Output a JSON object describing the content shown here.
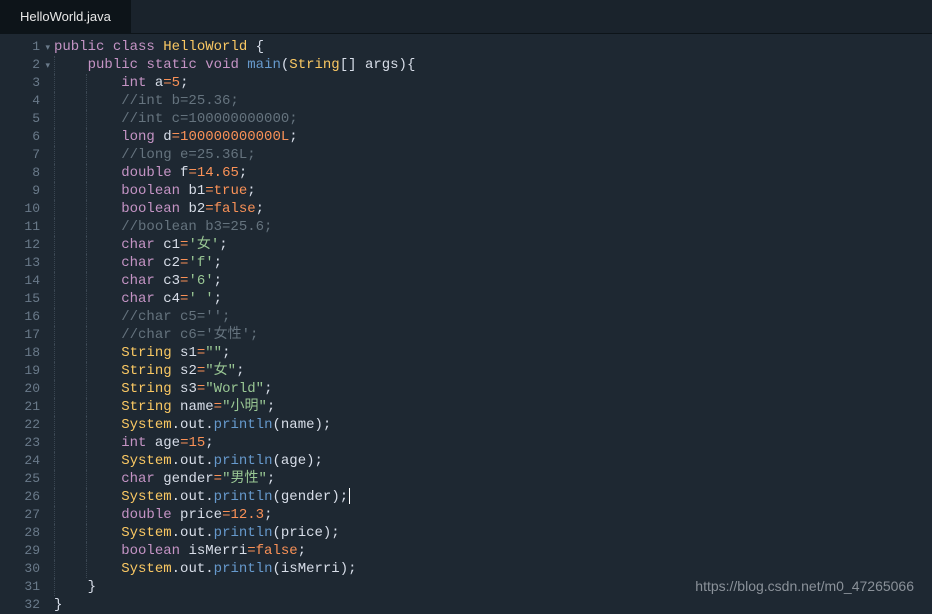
{
  "tab": {
    "filename": "HelloWorld.java"
  },
  "watermark": "https://blog.csdn.net/m0_47265066",
  "lines": [
    {
      "n": 1,
      "fold": true,
      "indent": 0,
      "tokens": [
        [
          "kw",
          "public"
        ],
        [
          "",
          ""
        ],
        [
          "kw",
          "class"
        ],
        [
          "",
          ""
        ],
        [
          "cls",
          "HelloWorld"
        ],
        [
          "",
          ""
        ],
        [
          "punct",
          "{"
        ]
      ]
    },
    {
      "n": 2,
      "fold": true,
      "indent": 1,
      "tokens": [
        [
          "kw",
          "public"
        ],
        [
          "",
          ""
        ],
        [
          "kw",
          "static"
        ],
        [
          "",
          ""
        ],
        [
          "type",
          "void"
        ],
        [
          "",
          ""
        ],
        [
          "fn",
          "main"
        ],
        [
          "punct",
          "("
        ],
        [
          "cls",
          "String"
        ],
        [
          "punct",
          "[]"
        ],
        [
          "",
          ""
        ],
        [
          "id",
          "args"
        ],
        [
          "punct",
          "){"
        ]
      ]
    },
    {
      "n": 3,
      "fold": false,
      "indent": 2,
      "tokens": [
        [
          "type",
          "int"
        ],
        [
          "",
          ""
        ],
        [
          "id",
          "a"
        ],
        [
          "op",
          "="
        ],
        [
          "num",
          "5"
        ],
        [
          "punct",
          ";"
        ]
      ]
    },
    {
      "n": 4,
      "fold": false,
      "indent": 2,
      "tokens": [
        [
          "comment",
          "//int b=25.36;"
        ]
      ]
    },
    {
      "n": 5,
      "fold": false,
      "indent": 2,
      "tokens": [
        [
          "comment",
          "//int c=100000000000;"
        ]
      ]
    },
    {
      "n": 6,
      "fold": false,
      "indent": 2,
      "tokens": [
        [
          "type",
          "long"
        ],
        [
          "",
          ""
        ],
        [
          "id",
          "d"
        ],
        [
          "op",
          "="
        ],
        [
          "num",
          "100000000000L"
        ],
        [
          "punct",
          ";"
        ]
      ]
    },
    {
      "n": 7,
      "fold": false,
      "indent": 2,
      "tokens": [
        [
          "comment",
          "//long e=25.36L;"
        ]
      ]
    },
    {
      "n": 8,
      "fold": false,
      "indent": 2,
      "tokens": [
        [
          "type",
          "double"
        ],
        [
          "",
          ""
        ],
        [
          "id",
          "f"
        ],
        [
          "op",
          "="
        ],
        [
          "num",
          "14.65"
        ],
        [
          "punct",
          ";"
        ]
      ]
    },
    {
      "n": 9,
      "fold": false,
      "indent": 2,
      "tokens": [
        [
          "type",
          "boolean"
        ],
        [
          "",
          ""
        ],
        [
          "id",
          "b1"
        ],
        [
          "op",
          "="
        ],
        [
          "bool",
          "true"
        ],
        [
          "punct",
          ";"
        ]
      ]
    },
    {
      "n": 10,
      "fold": false,
      "indent": 2,
      "tokens": [
        [
          "type",
          "boolean"
        ],
        [
          "",
          ""
        ],
        [
          "id",
          "b2"
        ],
        [
          "op",
          "="
        ],
        [
          "bool",
          "false"
        ],
        [
          "punct",
          ";"
        ]
      ]
    },
    {
      "n": 11,
      "fold": false,
      "indent": 2,
      "tokens": [
        [
          "comment",
          "//boolean b3=25.6;"
        ]
      ]
    },
    {
      "n": 12,
      "fold": false,
      "indent": 2,
      "tokens": [
        [
          "type",
          "char"
        ],
        [
          "",
          ""
        ],
        [
          "id",
          "c1"
        ],
        [
          "op",
          "="
        ],
        [
          "str",
          "'女'"
        ],
        [
          "punct",
          ";"
        ]
      ]
    },
    {
      "n": 13,
      "fold": false,
      "indent": 2,
      "tokens": [
        [
          "type",
          "char"
        ],
        [
          "",
          ""
        ],
        [
          "id",
          "c2"
        ],
        [
          "op",
          "="
        ],
        [
          "str",
          "'f'"
        ],
        [
          "punct",
          ";"
        ]
      ]
    },
    {
      "n": 14,
      "fold": false,
      "indent": 2,
      "tokens": [
        [
          "type",
          "char"
        ],
        [
          "",
          ""
        ],
        [
          "id",
          "c3"
        ],
        [
          "op",
          "="
        ],
        [
          "str",
          "'6'"
        ],
        [
          "punct",
          ";"
        ]
      ]
    },
    {
      "n": 15,
      "fold": false,
      "indent": 2,
      "tokens": [
        [
          "type",
          "char"
        ],
        [
          "",
          ""
        ],
        [
          "id",
          "c4"
        ],
        [
          "op",
          "="
        ],
        [
          "str",
          "' '"
        ],
        [
          "punct",
          ";"
        ]
      ]
    },
    {
      "n": 16,
      "fold": false,
      "indent": 2,
      "tokens": [
        [
          "comment",
          "//char c5='';"
        ]
      ]
    },
    {
      "n": 17,
      "fold": false,
      "indent": 2,
      "tokens": [
        [
          "comment",
          "//char c6='女性';"
        ]
      ]
    },
    {
      "n": 18,
      "fold": false,
      "indent": 2,
      "tokens": [
        [
          "cls",
          "String"
        ],
        [
          "",
          ""
        ],
        [
          "id",
          "s1"
        ],
        [
          "op",
          "="
        ],
        [
          "str",
          "\"\""
        ],
        [
          "punct",
          ";"
        ]
      ]
    },
    {
      "n": 19,
      "fold": false,
      "indent": 2,
      "tokens": [
        [
          "cls",
          "String"
        ],
        [
          "",
          ""
        ],
        [
          "id",
          "s2"
        ],
        [
          "op",
          "="
        ],
        [
          "str",
          "\"女\""
        ],
        [
          "punct",
          ";"
        ]
      ]
    },
    {
      "n": 20,
      "fold": false,
      "indent": 2,
      "tokens": [
        [
          "cls",
          "String"
        ],
        [
          "",
          ""
        ],
        [
          "id",
          "s3"
        ],
        [
          "op",
          "="
        ],
        [
          "str",
          "\"World\""
        ],
        [
          "punct",
          ";"
        ]
      ]
    },
    {
      "n": 21,
      "fold": false,
      "indent": 2,
      "tokens": [
        [
          "cls",
          "String"
        ],
        [
          "",
          ""
        ],
        [
          "id",
          "name"
        ],
        [
          "op",
          "="
        ],
        [
          "str",
          "\"小明\""
        ],
        [
          "punct",
          ";"
        ]
      ]
    },
    {
      "n": 22,
      "fold": false,
      "indent": 2,
      "tokens": [
        [
          "sys",
          "System"
        ],
        [
          "punct",
          "."
        ],
        [
          "id",
          "out"
        ],
        [
          "punct",
          "."
        ],
        [
          "fn",
          "println"
        ],
        [
          "punct",
          "("
        ],
        [
          "id",
          "name"
        ],
        [
          "punct",
          ");"
        ]
      ]
    },
    {
      "n": 23,
      "fold": false,
      "indent": 2,
      "tokens": [
        [
          "type",
          "int"
        ],
        [
          "",
          ""
        ],
        [
          "id",
          "age"
        ],
        [
          "op",
          "="
        ],
        [
          "num",
          "15"
        ],
        [
          "punct",
          ";"
        ]
      ]
    },
    {
      "n": 24,
      "fold": false,
      "indent": 2,
      "tokens": [
        [
          "sys",
          "System"
        ],
        [
          "punct",
          "."
        ],
        [
          "id",
          "out"
        ],
        [
          "punct",
          "."
        ],
        [
          "fn",
          "println"
        ],
        [
          "punct",
          "("
        ],
        [
          "id",
          "age"
        ],
        [
          "punct",
          ");"
        ]
      ]
    },
    {
      "n": 25,
      "fold": false,
      "indent": 2,
      "tokens": [
        [
          "type",
          "char"
        ],
        [
          "",
          ""
        ],
        [
          "id",
          "gender"
        ],
        [
          "op",
          "="
        ],
        [
          "str",
          "\"男性\""
        ],
        [
          "punct",
          ";"
        ]
      ]
    },
    {
      "n": 26,
      "fold": false,
      "indent": 2,
      "tokens": [
        [
          "sys",
          "System"
        ],
        [
          "punct",
          "."
        ],
        [
          "id",
          "out"
        ],
        [
          "punct",
          "."
        ],
        [
          "fn",
          "println"
        ],
        [
          "punct",
          "("
        ],
        [
          "id",
          "gender"
        ],
        [
          "punct",
          ");"
        ]
      ],
      "cursor": true
    },
    {
      "n": 27,
      "fold": false,
      "indent": 2,
      "tokens": [
        [
          "type",
          "double"
        ],
        [
          "",
          ""
        ],
        [
          "id",
          "price"
        ],
        [
          "op",
          "="
        ],
        [
          "num",
          "12.3"
        ],
        [
          "punct",
          ";"
        ]
      ]
    },
    {
      "n": 28,
      "fold": false,
      "indent": 2,
      "tokens": [
        [
          "sys",
          "System"
        ],
        [
          "punct",
          "."
        ],
        [
          "id",
          "out"
        ],
        [
          "punct",
          "."
        ],
        [
          "fn",
          "println"
        ],
        [
          "punct",
          "("
        ],
        [
          "id",
          "price"
        ],
        [
          "punct",
          ");"
        ]
      ]
    },
    {
      "n": 29,
      "fold": false,
      "indent": 2,
      "tokens": [
        [
          "type",
          "boolean"
        ],
        [
          "",
          ""
        ],
        [
          "id",
          "isMerri"
        ],
        [
          "op",
          "="
        ],
        [
          "bool",
          "false"
        ],
        [
          "punct",
          ";"
        ]
      ]
    },
    {
      "n": 30,
      "fold": false,
      "indent": 2,
      "tokens": [
        [
          "sys",
          "System"
        ],
        [
          "punct",
          "."
        ],
        [
          "id",
          "out"
        ],
        [
          "punct",
          "."
        ],
        [
          "fn",
          "println"
        ],
        [
          "punct",
          "("
        ],
        [
          "id",
          "isMerri"
        ],
        [
          "punct",
          ");"
        ]
      ]
    },
    {
      "n": 31,
      "fold": false,
      "indent": 1,
      "tokens": [
        [
          "punct",
          "}"
        ]
      ]
    },
    {
      "n": 32,
      "fold": false,
      "indent": 0,
      "tokens": [
        [
          "punct",
          "}"
        ]
      ]
    }
  ]
}
